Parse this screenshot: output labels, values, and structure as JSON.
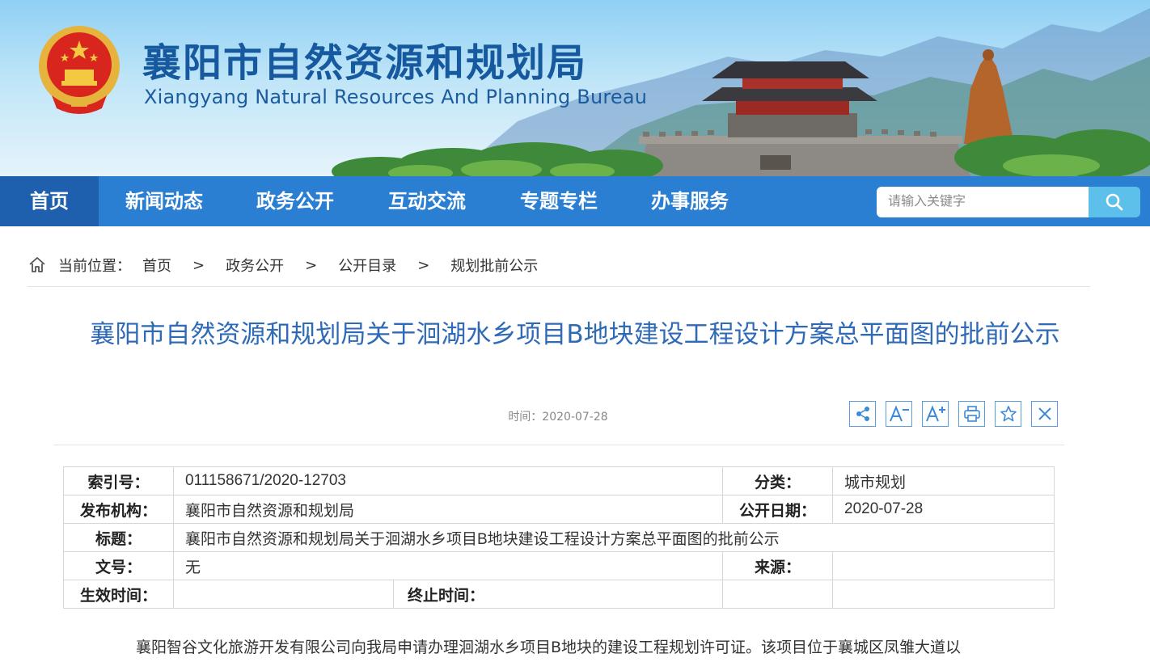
{
  "header": {
    "title": "襄阳市自然资源和规划局",
    "subtitle": "Xiangyang Natural Resources And Planning Bureau"
  },
  "nav": {
    "items": [
      "首页",
      "新闻动态",
      "政务公开",
      "互动交流",
      "专题专栏",
      "办事服务"
    ],
    "active": "首页",
    "search_placeholder": "请输入关键字"
  },
  "breadcrumb": {
    "label": "当前位置：",
    "items": [
      "首页",
      "政务公开",
      "公开目录",
      "规划批前公示"
    ],
    "separator": ">"
  },
  "article": {
    "title": "襄阳市自然资源和规划局关于洄湖水乡项目B地块建设工程设计方案总平面图的批前公示",
    "time": "时间：2020-07-28",
    "tools": [
      "share-icon",
      "font-decrease-icon",
      "font-increase-icon",
      "print-icon",
      "favorite-icon",
      "close-icon"
    ]
  },
  "meta": {
    "index_label": "索引号：",
    "index_value": "011158671/2020-12703",
    "category_label": "分类：",
    "category_value": "城市规划",
    "publisher_label": "发布机构：",
    "publisher_value": "襄阳市自然资源和规划局",
    "date_label": "公开日期：",
    "date_value": "2020-07-28",
    "subject_label": "标题：",
    "subject_value": "襄阳市自然资源和规划局关于洄湖水乡项目B地块建设工程设计方案总平面图的批前公示",
    "docno_label": "文号：",
    "docno_value": "无",
    "source_label": "来源：",
    "source_value": "",
    "effective_label": "生效时间：",
    "effective_value": "",
    "expire_label": "终止时间：",
    "expire_value": ""
  },
  "body": {
    "paragraph": "襄阳智谷文化旅游开发有限公司向我局申请办理洄湖水乡项目B地块的建设工程规划许可证。该项目位于襄城区凤雏大道以"
  },
  "colors": {
    "nav_bg": "#2b7fd2",
    "nav_active": "#1e5fae",
    "title_blue": "#2f6ab6",
    "search_btn": "#5cc0ea"
  }
}
